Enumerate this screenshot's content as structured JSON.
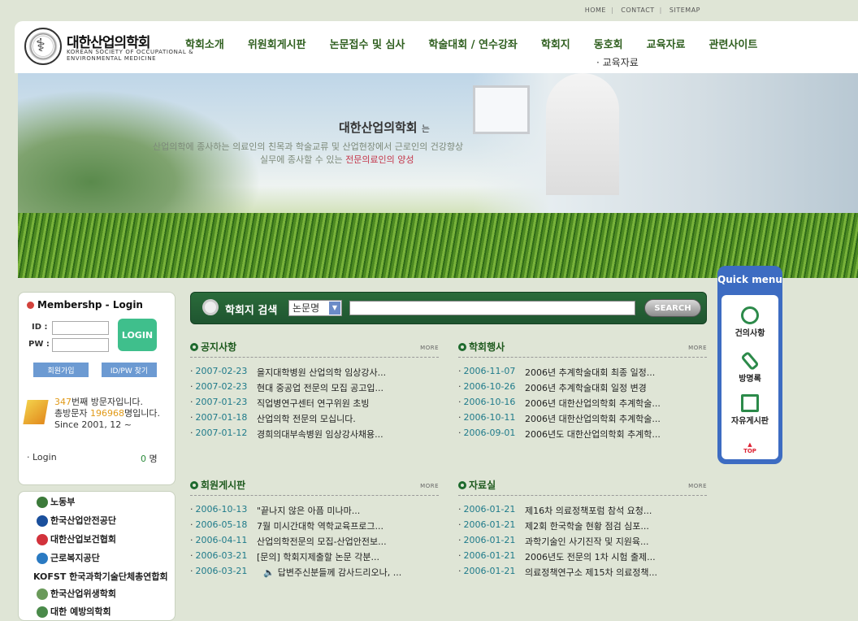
{
  "topbar": {
    "home": "HOME",
    "contact": "CONTACT",
    "sitemap": "SITEMAP"
  },
  "logo": {
    "name": "대한산업의학회",
    "sub": "KOREAN SOCIETY OF OCCUPATIONAL & ENVIRONMENTAL MEDICINE"
  },
  "nav": [
    "학회소개",
    "위원회게시판",
    "논문접수 및 심사",
    "학술대회 / 연수강좌",
    "학회지",
    "동호회",
    "교육자료",
    "관련사이트"
  ],
  "subnav": "· 교육자료",
  "banner": {
    "title": "대한산업의학회",
    "title_suffix": "는",
    "line1": "산업의학에 종사하는 의료인의 친목과 학술교류 및 산업현장에서 근로인의 건강향상",
    "line2_a": "실무에 종사할 수 있는 ",
    "line2_b": "전문의료인의 양성"
  },
  "login": {
    "title": "Membershp - Login",
    "id_label": "ID :",
    "pw_label": "PW :",
    "login_btn": "LOGIN",
    "join_btn": "회원가입",
    "find_btn": "ID/PW 찾기",
    "visitor_num": "347",
    "visitor_text": "번째 방문자입니다.",
    "total_label": "총방문자 ",
    "total_num": "196968",
    "total_text": "명입니다.",
    "since": "Since 2001, 12 ~",
    "online_label": "· Login",
    "online_num": "0",
    "online_unit": " 명"
  },
  "links": [
    "노동부",
    "한국산업안전공단",
    "대한산업보건협회",
    "근로복지공단",
    "KOFST 한국과학기술단체총연합회",
    "한국산업위생학회",
    "대한 예방의학회"
  ],
  "search": {
    "label": "학회지 검색",
    "select": "논문명",
    "button": "SEARCH"
  },
  "boards": {
    "notice": {
      "title": "공지사항",
      "more": "MORE",
      "rows": [
        {
          "date": "2007-02-23",
          "text": "을지대학병원 산업의학 임상강사..."
        },
        {
          "date": "2007-02-23",
          "text": "현대 중공업 전문의 모집 공고입..."
        },
        {
          "date": "2007-01-23",
          "text": "직업병연구센터 연구위원 초빙"
        },
        {
          "date": "2007-01-18",
          "text": "산업의학 전문의 모십니다."
        },
        {
          "date": "2007-01-12",
          "text": "경희의대부속병원 임상강사채용..."
        }
      ]
    },
    "events": {
      "title": "학회행사",
      "more": "MORE",
      "rows": [
        {
          "date": "2006-11-07",
          "text": "2006년 추계학술대회 최종 일정..."
        },
        {
          "date": "2006-10-26",
          "text": "2006년 추계학술대회 일정 변경"
        },
        {
          "date": "2006-10-16",
          "text": "2006년 대한산업의학회 추계학술..."
        },
        {
          "date": "2006-10-11",
          "text": "2006년 대한산업의학회 추계학술..."
        },
        {
          "date": "2006-09-01",
          "text": "2006년도 대한산업의학회 추계학..."
        }
      ]
    },
    "members": {
      "title": "회원게시판",
      "more": "MORE",
      "rows": [
        {
          "date": "2006-10-13",
          "text": "\"끝나지 않은 아픔 미나마..."
        },
        {
          "date": "2006-05-18",
          "text": "7월 미시간대학 역학교육프로그..."
        },
        {
          "date": "2006-04-11",
          "text": "산업의학전문의 모집-산업안전보..."
        },
        {
          "date": "2006-03-21",
          "text": "[문의] 학회지제출할 논문 각분..."
        },
        {
          "date": "2006-03-21",
          "text": "답변주신분들께 감사드리오나, ..."
        }
      ]
    },
    "archive": {
      "title": "자료실",
      "more": "MORE",
      "rows": [
        {
          "date": "2006-01-21",
          "text": "제16차 의료정책포럼 참석 요청..."
        },
        {
          "date": "2006-01-21",
          "text": "제2회 한국학술 현황 점검 심포..."
        },
        {
          "date": "2006-01-21",
          "text": "과학기술인 사기진작 및 지원육..."
        },
        {
          "date": "2006-01-21",
          "text": "2006년도 전문의 1차 시험 출제..."
        },
        {
          "date": "2006-01-21",
          "text": "의료정책연구소 제15차 의료정책..."
        }
      ]
    }
  },
  "quick": {
    "title": "Quick menu",
    "items": [
      "건의사항",
      "방명록",
      "자유게시판"
    ],
    "top": "TOP"
  }
}
